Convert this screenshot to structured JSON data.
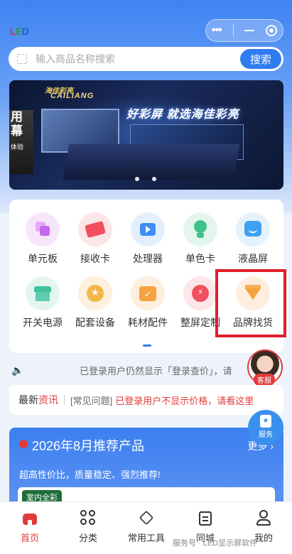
{
  "app": {
    "logo_text": [
      "L",
      "E",
      "D"
    ]
  },
  "capsule": {
    "more": "•••",
    "minimize": "—",
    "close": "◎"
  },
  "search": {
    "placeholder": "输入商品名称搜索",
    "button": "搜索"
  },
  "banner": {
    "brand_cn": "海佳彩亮",
    "brand_en": "CAILIANG",
    "slogan_pre": "好彩屏 就选",
    "slogan_brand": "海佳彩亮",
    "side_text": "用\n幕",
    "side_small": "体验"
  },
  "categories": [
    {
      "label": "单元板",
      "icon": "module-icon",
      "color": "#f6e6fb",
      "accent": "#c667ef"
    },
    {
      "label": "接收卡",
      "icon": "ticket-icon",
      "color": "#fde6e8",
      "accent": "#f0505f"
    },
    {
      "label": "处理器",
      "icon": "video-icon",
      "color": "#e4effd",
      "accent": "#3f8ef5"
    },
    {
      "label": "单色卡",
      "icon": "bulb-icon",
      "color": "#e2f6ee",
      "accent": "#3fc28a"
    },
    {
      "label": "液晶屏",
      "icon": "screen-face-icon",
      "color": "#e4f2fd",
      "accent": "#3fa0f0"
    },
    {
      "label": "开关电源",
      "icon": "store-icon",
      "color": "#e2f6ee",
      "accent": "#3fc2a0"
    },
    {
      "label": "配套设备",
      "icon": "medal-icon",
      "color": "#fdf0dc",
      "accent": "#f3b64a"
    },
    {
      "label": "耗材配件",
      "icon": "calendar-icon",
      "color": "#fdeedd",
      "accent": "#f4a340"
    },
    {
      "label": "整屏定制",
      "icon": "alarm-icon",
      "color": "#fde6e8",
      "accent": "#f0505f"
    },
    {
      "label": "品牌找货",
      "icon": "diamond-icon",
      "color": "#fdeedd",
      "accent": "#f4a340"
    }
  ],
  "notice": {
    "text": "已登录用户仍然显示「登录查价」，请"
  },
  "customer_service": {
    "tag": "客服"
  },
  "news": {
    "title_a": "最新",
    "title_b": "资讯",
    "category": "[常见问题]",
    "headline": "已登录用户不显示价格，请看这里"
  },
  "service_button": {
    "label": "服务"
  },
  "promo": {
    "title": "2026年8月推荐产品",
    "more": "更多 ›",
    "subtitle": "超高性价比，质量稳定、强烈推荐!",
    "tag": "室内全彩"
  },
  "tabbar": [
    {
      "label": "首页",
      "icon": "home-icon",
      "active": true
    },
    {
      "label": "分类",
      "icon": "grid-icon",
      "active": false
    },
    {
      "label": "常用工具",
      "icon": "diamond-outline-icon",
      "active": false
    },
    {
      "label": "同城",
      "icon": "clipboard-icon",
      "active": false
    },
    {
      "label": "我的",
      "icon": "user-icon",
      "active": false
    }
  ],
  "watermark": "服务号 · LED显示屏软件"
}
